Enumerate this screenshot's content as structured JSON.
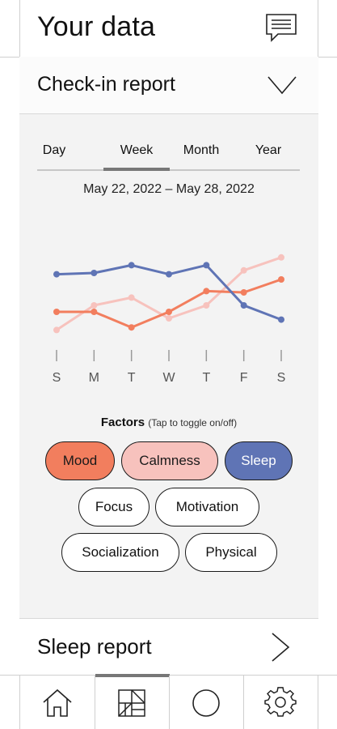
{
  "header": {
    "title": "Your data",
    "icon": "chat-bubble-icon"
  },
  "checkin": {
    "label": "Check-in report",
    "icon": "chevron-down-icon"
  },
  "tabs": [
    {
      "label": "Day",
      "active": false
    },
    {
      "label": "Week",
      "active": true
    },
    {
      "label": "Month",
      "active": false
    },
    {
      "label": "Year",
      "active": false
    }
  ],
  "date_range": "May 22, 2022 – May 28, 2022",
  "chart_data": {
    "type": "line",
    "categories": [
      "S",
      "M",
      "T",
      "W",
      "T",
      "F",
      "S"
    ],
    "y_range": [
      0,
      10
    ],
    "grid": false,
    "series": [
      {
        "name": "Sleep",
        "color": "#5f74b5",
        "values": [
          6.9,
          7.0,
          7.6,
          6.9,
          7.6,
          4.5,
          3.4
        ]
      },
      {
        "name": "Mood",
        "color": "#f27e5e",
        "values": [
          4.0,
          4.0,
          2.8,
          4.0,
          5.6,
          5.5,
          6.5
        ]
      },
      {
        "name": "Calmness",
        "color": "#f7c2bd",
        "values": [
          2.6,
          4.5,
          5.1,
          3.5,
          4.5,
          7.2,
          8.2
        ]
      }
    ]
  },
  "factors": {
    "title": "Factors",
    "hint": "(Tap to toggle on/off)",
    "items": [
      {
        "label": "Mood",
        "on": true,
        "color": "#f27e5e",
        "text_color": "#1a1a1a"
      },
      {
        "label": "Calmness",
        "on": true,
        "color": "#f7c2bd",
        "text_color": "#1a1a1a"
      },
      {
        "label": "Sleep",
        "on": true,
        "color": "#5f74b5",
        "text_color": "#ffffff"
      },
      {
        "label": "Focus",
        "on": false
      },
      {
        "label": "Motivation",
        "on": false
      },
      {
        "label": "Socialization",
        "on": false
      },
      {
        "label": "Physical",
        "on": false
      }
    ]
  },
  "sleep_report": {
    "label": "Sleep report",
    "icon": "chevron-right-icon"
  },
  "nav": [
    {
      "icon": "home-icon",
      "active": false
    },
    {
      "icon": "data-grid-icon",
      "active": true
    },
    {
      "icon": "circle-icon",
      "active": false
    },
    {
      "icon": "gear-icon",
      "active": false
    }
  ]
}
